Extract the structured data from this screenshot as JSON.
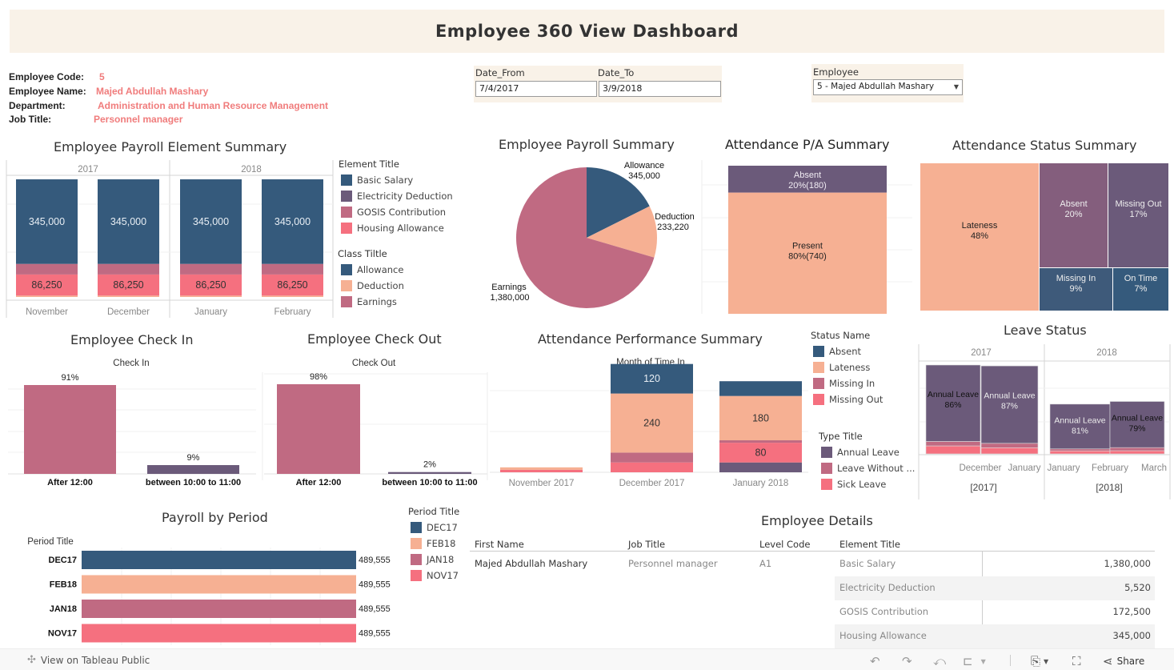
{
  "header": {
    "title": "Employee 360 View Dashboard"
  },
  "employee_info": {
    "code_label": "Employee Code:",
    "code": "5",
    "name_label": "Employee Name:",
    "name": "Majed Abdullah Mashary",
    "dept_label": "Department:",
    "dept": "Administration and Human Resource Management",
    "job_label": "Job Title:",
    "job": "Personnel manager"
  },
  "filters": {
    "date_from_label": "Date_From",
    "date_from": "7/4/2017",
    "date_to_label": "Date_To",
    "date_to": "3/9/2018",
    "employee_label": "Employee",
    "employee": "5 - Majed Abdullah Mashary"
  },
  "colors": {
    "navy": "#355a7c",
    "peach": "#f6b093",
    "mauve": "#c06a82",
    "coral": "#f5707f",
    "purple": "#6b5a7a",
    "purple2": "#845e7d",
    "navy2": "#3e5a7a"
  },
  "chart_data": [
    {
      "id": "payroll_element",
      "type": "bar",
      "title": "Employee Payroll Element Summary",
      "years": [
        "2017",
        "2018"
      ],
      "categories": [
        "November",
        "December",
        "January",
        "February"
      ],
      "series": [
        {
          "name": "Deduction (base)",
          "color": "#f6b093",
          "values": [
            5520,
            5520,
            5520,
            5520
          ]
        },
        {
          "name": "Housing Allowance",
          "color": "#f5707f",
          "values": [
            86250,
            86250,
            86250,
            86250
          ],
          "labels": [
            "86,250",
            "86,250",
            "86,250",
            "86,250"
          ]
        },
        {
          "name": "GOSIS Contribution",
          "color": "#c06a82",
          "values": [
            43125,
            43125,
            43125,
            43125
          ]
        },
        {
          "name": "Basic Salary",
          "color": "#355a7c",
          "values": [
            345000,
            345000,
            345000,
            345000
          ],
          "labels": [
            "345,000",
            "345,000",
            "345,000",
            "345,000"
          ]
        }
      ],
      "legend_element_title": "Element Title",
      "legend_element": [
        {
          "label": "Basic Salary",
          "color": "#355a7c"
        },
        {
          "label": "Electricity Deduction",
          "color": "#6b5a7a"
        },
        {
          "label": "GOSIS Contribution",
          "color": "#c06a82"
        },
        {
          "label": "Housing Allowance",
          "color": "#f5707f"
        }
      ],
      "legend_class_title": "Class Tiltle",
      "legend_class": [
        {
          "label": "Allowance",
          "color": "#355a7c"
        },
        {
          "label": "Deduction",
          "color": "#f6b093"
        },
        {
          "label": "Earnings",
          "color": "#c06a82"
        }
      ]
    },
    {
      "id": "payroll_summary",
      "type": "pie",
      "title": "Employee Payroll Summary",
      "slices": [
        {
          "name": "Allowance",
          "value": 345000,
          "label": "345,000",
          "color": "#355a7c"
        },
        {
          "name": "Deduction",
          "value": 233220,
          "label": "233,220",
          "color": "#f6b093"
        },
        {
          "name": "Earnings",
          "value": 1380000,
          "label": "1,380,000",
          "color": "#c06a82"
        }
      ]
    },
    {
      "id": "pa_summary",
      "type": "bar",
      "title": "Attendance P/A Summary",
      "segments": [
        {
          "name": "Absent",
          "pct": 20,
          "count": 180,
          "label": "20%(180)",
          "color": "#6b5a7a"
        },
        {
          "name": "Present",
          "pct": 80,
          "count": 740,
          "label": "80%(740)",
          "color": "#f6b093"
        }
      ]
    },
    {
      "id": "status_summary",
      "type": "heatmap",
      "title": "Attendance Status Summary",
      "cells": [
        {
          "name": "Lateness",
          "pct": 48,
          "label": "48%",
          "color": "#f6b093"
        },
        {
          "name": "Absent",
          "pct": 20,
          "label": "20%",
          "color": "#845e7d"
        },
        {
          "name": "Missing Out",
          "pct": 17,
          "label": "17%",
          "color": "#6b5a7a"
        },
        {
          "name": "Missing In",
          "pct": 9,
          "label": "9%",
          "color": "#3e5a7a"
        },
        {
          "name": "On Time",
          "pct": 7,
          "label": "7%",
          "color": "#355a7c"
        }
      ]
    },
    {
      "id": "check_in",
      "type": "bar",
      "title": "Employee Check In",
      "subtitle": "Check In",
      "categories": [
        "After 12:00",
        "between 10:00 to 11:00"
      ],
      "values": [
        91,
        9
      ],
      "labels": [
        "91%",
        "9%"
      ],
      "colors": [
        "#c06a82",
        "#6b5a7a"
      ],
      "ylim": [
        0,
        100
      ]
    },
    {
      "id": "check_out",
      "type": "bar",
      "title": "Employee Check Out",
      "subtitle": "Check Out",
      "categories": [
        "After 12:00",
        "between 10:00 to 11:00"
      ],
      "values": [
        98,
        2
      ],
      "labels": [
        "98%",
        "2%"
      ],
      "colors": [
        "#c06a82",
        "#6b5a7a"
      ],
      "ylim": [
        0,
        100
      ]
    },
    {
      "id": "performance",
      "type": "bar",
      "title": "Attendance Performance Summary",
      "subtitle": "Month of Time In",
      "categories": [
        "November 2017",
        "December 2017",
        "January 2018"
      ],
      "series": [
        {
          "name": "Annual Leave",
          "color": "#6b5a7a",
          "values": [
            0,
            0,
            40
          ]
        },
        {
          "name": "Sick Leave / Missing Out",
          "color": "#f5707f",
          "values": [
            10,
            40,
            80
          ],
          "labels": [
            "",
            "",
            "80"
          ]
        },
        {
          "name": "Missing In",
          "color": "#c06a82",
          "values": [
            0,
            40,
            10
          ]
        },
        {
          "name": "Lateness",
          "color": "#f6b093",
          "values": [
            10,
            240,
            180
          ],
          "labels": [
            "",
            "240",
            "180"
          ]
        },
        {
          "name": "Absent",
          "color": "#355a7c",
          "values": [
            0,
            120,
            60
          ],
          "labels": [
            "",
            "120",
            ""
          ]
        }
      ],
      "ylim": [
        0,
        480
      ],
      "legend_status_title": "Status Name",
      "legend_status": [
        {
          "label": "Absent",
          "color": "#355a7c"
        },
        {
          "label": "Lateness",
          "color": "#f6b093"
        },
        {
          "label": "Missing In",
          "color": "#c06a82"
        },
        {
          "label": "Missing Out",
          "color": "#f5707f"
        }
      ],
      "legend_type_title": "Type Title",
      "legend_type": [
        {
          "label": "Annual Leave",
          "color": "#6b5a7a"
        },
        {
          "label": "Leave Without ...",
          "color": "#c06a82"
        },
        {
          "label": "Sick Leave",
          "color": "#f5707f"
        }
      ]
    },
    {
      "id": "leave_status",
      "type": "bar",
      "title": "Leave Status",
      "years": [
        "2017",
        "2018"
      ],
      "year_labels": [
        "[2017]",
        "[2018]"
      ],
      "month_labels": [
        "December",
        "January",
        "January",
        "February",
        "March"
      ],
      "bars": [
        {
          "annual_pct": 86,
          "label": "Annual Leave\n86%",
          "total": 100,
          "mauve": 5,
          "coral": 9
        },
        {
          "annual_pct": 87,
          "label": "Annual Leave\n87%",
          "total": 99,
          "mauve": 5,
          "coral": 7
        },
        {
          "annual_pct": 81,
          "label": "Annual Leave\n81%",
          "total": 56,
          "mauve": 4,
          "coral": 6
        },
        {
          "annual_pct": 79,
          "label": "Annual Leave\n79%",
          "total": 59,
          "mauve": 6,
          "coral": 6
        }
      ]
    },
    {
      "id": "payroll_period",
      "type": "bar",
      "title": "Payroll by Period",
      "axis_title": "Period Title",
      "categories": [
        "DEC17",
        "FEB18",
        "JAN18",
        "NOV17"
      ],
      "values": [
        489555,
        489555,
        489555,
        489555
      ],
      "labels": [
        "489,555",
        "489,555",
        "489,555",
        "489,555"
      ],
      "colors": [
        "#355a7c",
        "#f6b093",
        "#c06a82",
        "#f5707f"
      ],
      "legend_title": "Period Title",
      "legend": [
        {
          "label": "DEC17",
          "color": "#355a7c"
        },
        {
          "label": "FEB18",
          "color": "#f6b093"
        },
        {
          "label": "JAN18",
          "color": "#c06a82"
        },
        {
          "label": "NOV17",
          "color": "#f5707f"
        }
      ]
    }
  ],
  "details": {
    "title": "Employee Details",
    "headers": [
      "First Name",
      "Job Title",
      "Level Code",
      "Element Title"
    ],
    "first_name": "Majed Abdullah Mashary",
    "job_title": "Personnel manager",
    "level_code": "A1",
    "rows": [
      {
        "element": "Basic Salary",
        "value": "1,380,000"
      },
      {
        "element": "Electricity Deduction",
        "value": "5,520"
      },
      {
        "element": "GOSIS Contribution",
        "value": "172,500"
      },
      {
        "element": "Housing Allowance",
        "value": "345,000"
      }
    ]
  },
  "toolbar": {
    "view_label": "View on Tableau Public",
    "share_label": "Share"
  }
}
